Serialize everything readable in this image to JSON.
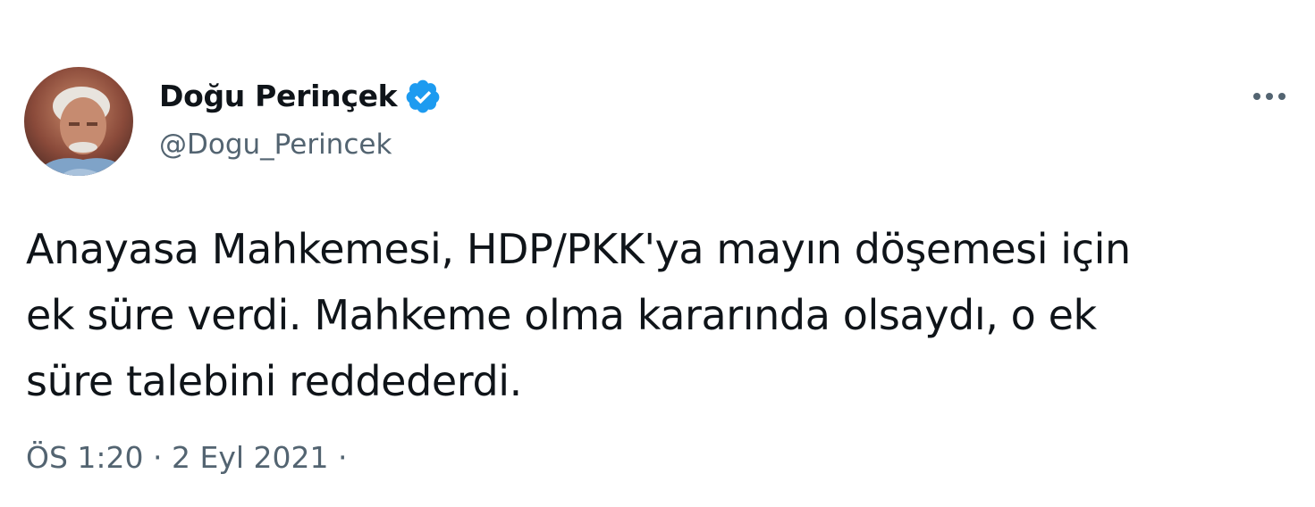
{
  "tweet": {
    "author": {
      "display_name": "Doğu Perinçek",
      "handle": "@Dogu_Perincek",
      "verified": true,
      "avatar_icon": "profile-photo",
      "verified_icon": "verified-badge-icon"
    },
    "text": "Anayasa Mahkemesi, HDP/PKK'ya mayın döşemesi için\nek süre verdi. Mahkeme olma kararında olsaydı, o ek\nsüre talebini reddederdi.",
    "timestamp": {
      "time": "ÖS 1:20",
      "separator": " · ",
      "date": "2 Eyl 2021",
      "trailing": " ·"
    },
    "more_icon": "more-horizontal-icon"
  },
  "colors": {
    "text_primary": "#0f1419",
    "text_secondary": "#536471",
    "verified_blue": "#1d9bf0",
    "background": "#ffffff"
  }
}
